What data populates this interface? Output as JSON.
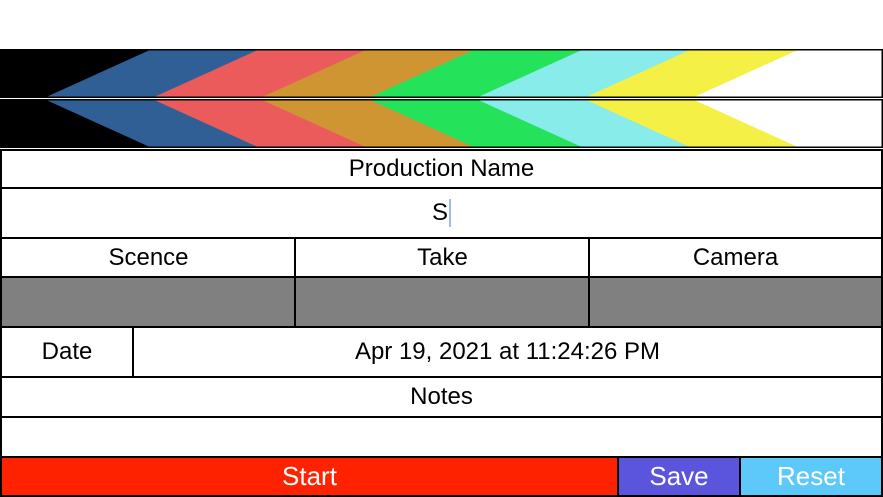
{
  "clapper": {
    "stripe_colors": [
      "#000000",
      "#2f5f95",
      "#ec5b5b",
      "#cf9533",
      "#25e25b",
      "#88ecea",
      "#f4f046",
      "#ffffff"
    ]
  },
  "form": {
    "production_label": "Production Name",
    "production_value": "S",
    "headers": [
      "Scence",
      "Take",
      "Camera"
    ],
    "values": [
      "",
      "",
      ""
    ],
    "date_label": "Date",
    "date_value": "Apr 19, 2021 at 11:24:26 PM",
    "notes_label": "Notes",
    "notes_value": ""
  },
  "buttons": {
    "start": {
      "label": "Start",
      "color": "#ff2200"
    },
    "save": {
      "label": "Save",
      "color": "#5a55dc"
    },
    "reset": {
      "label": "Reset",
      "color": "#5dc8fa"
    }
  }
}
